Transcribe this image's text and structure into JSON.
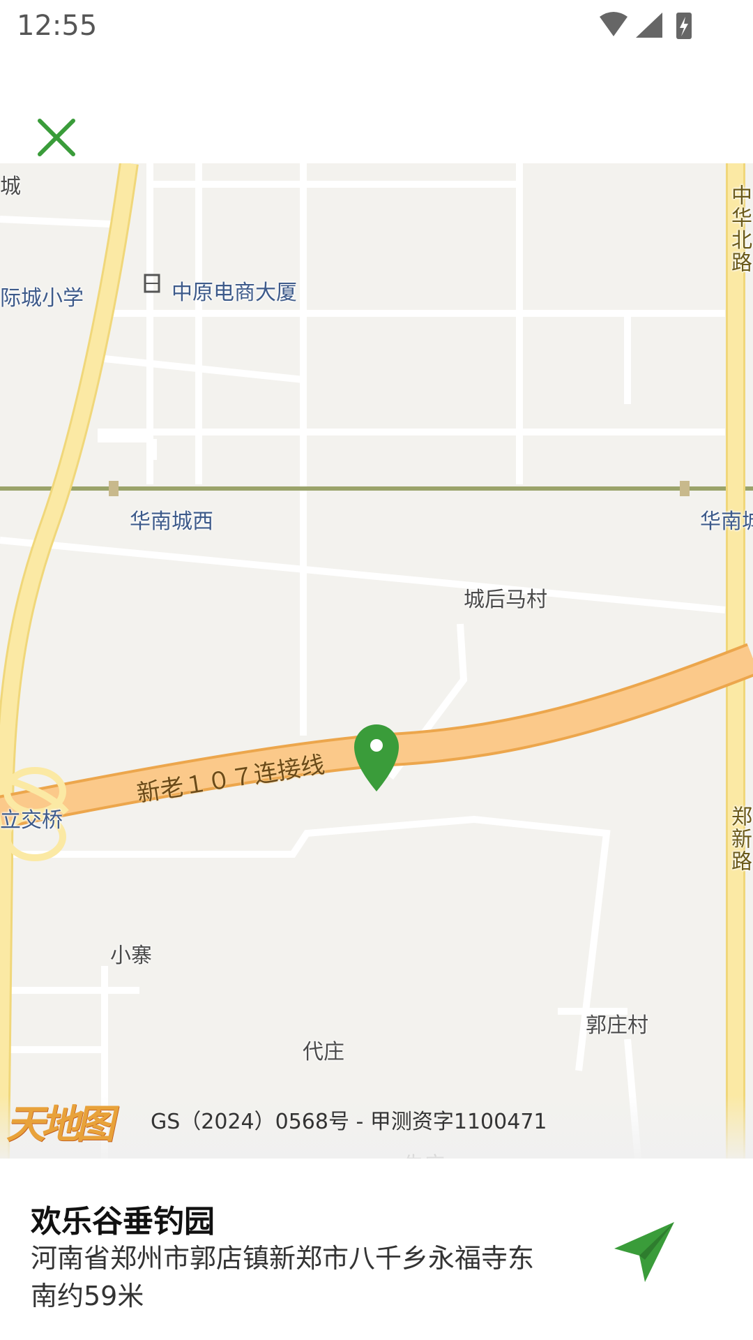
{
  "status_bar": {
    "time": "12:55"
  },
  "toolbar": {
    "close_icon": "close-icon"
  },
  "map": {
    "labels": {
      "cheng_top": "城",
      "school": "际城小学",
      "building": "中原电商大厦",
      "station_west": "华南城西",
      "station_right": "华南城",
      "village_chenghou": "城后马村",
      "interchange": "立交桥",
      "road_107": "新老１０７连接线",
      "xiaozhai": "小寨",
      "daizhuang": "代庄",
      "guozhuang": "郭庄村",
      "bottom_cut": "朱庄",
      "zhonghua_road": "中华北路",
      "right_road2": "郑新路"
    },
    "pin_color": "#3a9c3a"
  },
  "attribution": {
    "logo": "天地图",
    "copyright": "GS（2024）0568号 - 甲测资字1100471"
  },
  "place": {
    "name": "欢乐谷垂钓园",
    "address": "河南省郑州市郭店镇新郑市八千乡永福寺东南约59米"
  },
  "colors": {
    "accent": "#3a9c3a"
  }
}
